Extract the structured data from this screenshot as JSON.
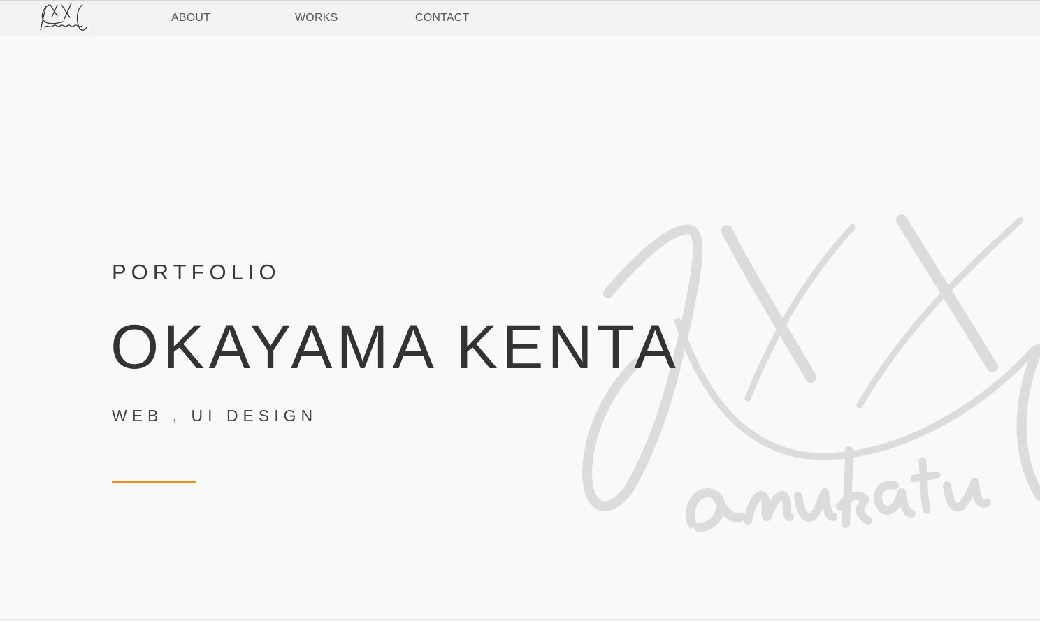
{
  "header": {
    "logo_icon": "signature-logo-icon",
    "nav": [
      {
        "label": "ABOUT"
      },
      {
        "label": "WORKS"
      },
      {
        "label": "CONTACT"
      }
    ]
  },
  "hero": {
    "eyebrow": "PORTFOLIO",
    "title": "OKAYAMA KENTA",
    "subtitle": "WEB , UI DESIGN",
    "watermark_icon": "signature-watermark-icon"
  },
  "colors": {
    "accent": "#e8901c",
    "text": "#333333",
    "background": "#f9f9f9",
    "header_bg": "#f3f3f3",
    "watermark": "#dcdcdc"
  }
}
